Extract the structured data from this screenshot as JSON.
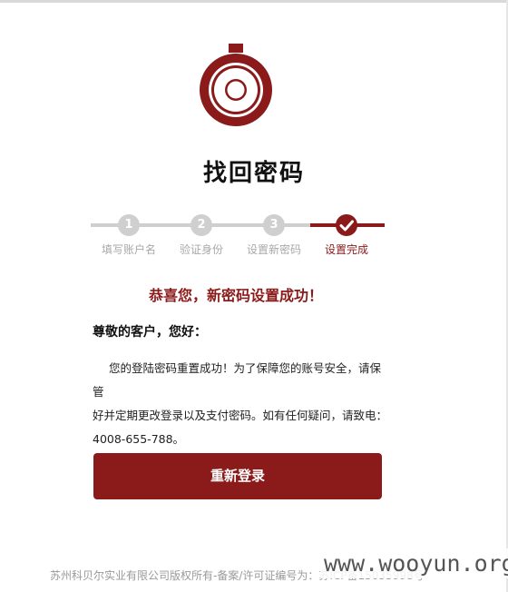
{
  "page": {
    "title": "找回密码"
  },
  "steps": [
    {
      "number": "1",
      "label": "填写账户名",
      "state": "done"
    },
    {
      "number": "2",
      "label": "验证身份",
      "state": "done"
    },
    {
      "number": "3",
      "label": "设置新密码",
      "state": "done"
    },
    {
      "number": "",
      "label": "设置完成",
      "state": "active"
    }
  ],
  "message": {
    "success": "恭喜您，新密码设置成功！",
    "greeting": "尊敬的客户，您好：",
    "body_line1": "您的登陆密码重置成功！为了保障您的账号安全，请保管",
    "body_line2": "好并定期更改登录以及支付密码。如有任何疑问，请致电：",
    "body_line3": "4008-655-788。"
  },
  "actions": {
    "relogin_label": "重新登录"
  },
  "footer": {
    "copyright": "苏州科贝尔实业有限公司版权所有-备案/许可证编号为：苏ICP备15035998号"
  },
  "watermark": {
    "text": "www.wooyun.org"
  },
  "colors": {
    "brand": "#8b1a1a",
    "step_inactive": "#cfcfcf",
    "muted_text": "#a8a8a8"
  }
}
